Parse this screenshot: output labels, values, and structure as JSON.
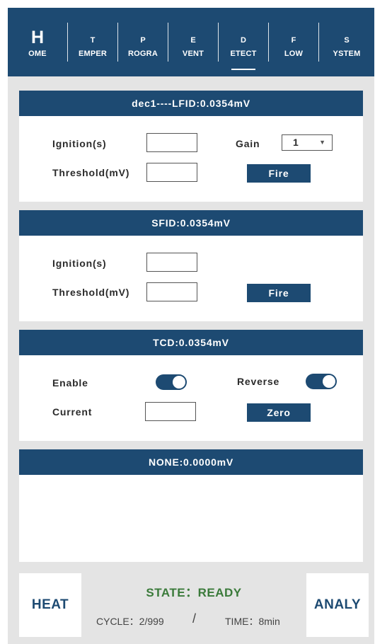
{
  "nav": {
    "tabs": [
      {
        "big": "H",
        "small": "OME",
        "active": false
      },
      {
        "big": "T",
        "small": "EMPER",
        "active": false
      },
      {
        "big": "P",
        "small": "ROGRA",
        "active": false
      },
      {
        "big": "E",
        "small": "VENT",
        "active": false
      },
      {
        "big": "D",
        "small": "ETECT",
        "active": true
      },
      {
        "big": "F",
        "small": "LOW",
        "active": false
      },
      {
        "big": "S",
        "small": "YSTEM",
        "active": false
      }
    ]
  },
  "detectors": {
    "fid1": {
      "title": "dec1----LFID:0.0354mV",
      "ignition_label": "Ignition(s)",
      "ignition_value": "",
      "threshold_label": "Threshold(mV)",
      "threshold_value": "",
      "gain_label": "Gain",
      "gain_value": "1",
      "fire_label": "Fire"
    },
    "fid2": {
      "title": "SFID:0.0354mV",
      "ignition_label": "Ignition(s)",
      "ignition_value": "",
      "threshold_label": "Threshold(mV)",
      "threshold_value": "",
      "fire_label": "Fire"
    },
    "tcd": {
      "title": "TCD:0.0354mV",
      "enable_label": "Enable",
      "enable_on": true,
      "reverse_label": "Reverse",
      "reverse_on": true,
      "current_label": "Current",
      "current_value": "",
      "zero_label": "Zero"
    },
    "none": {
      "title": "NONE:0.0000mV"
    }
  },
  "footer": {
    "heat_label": "HEAT",
    "analy_label": "ANALY",
    "state_text": "STATE：READY",
    "cycle_text": "CYCLE：2/999",
    "separator": "/",
    "time_text": "TIME：8min"
  },
  "colors": {
    "primary": "#1d4a72",
    "state_green": "#3a7a3a",
    "background": "#e4e4e4"
  }
}
